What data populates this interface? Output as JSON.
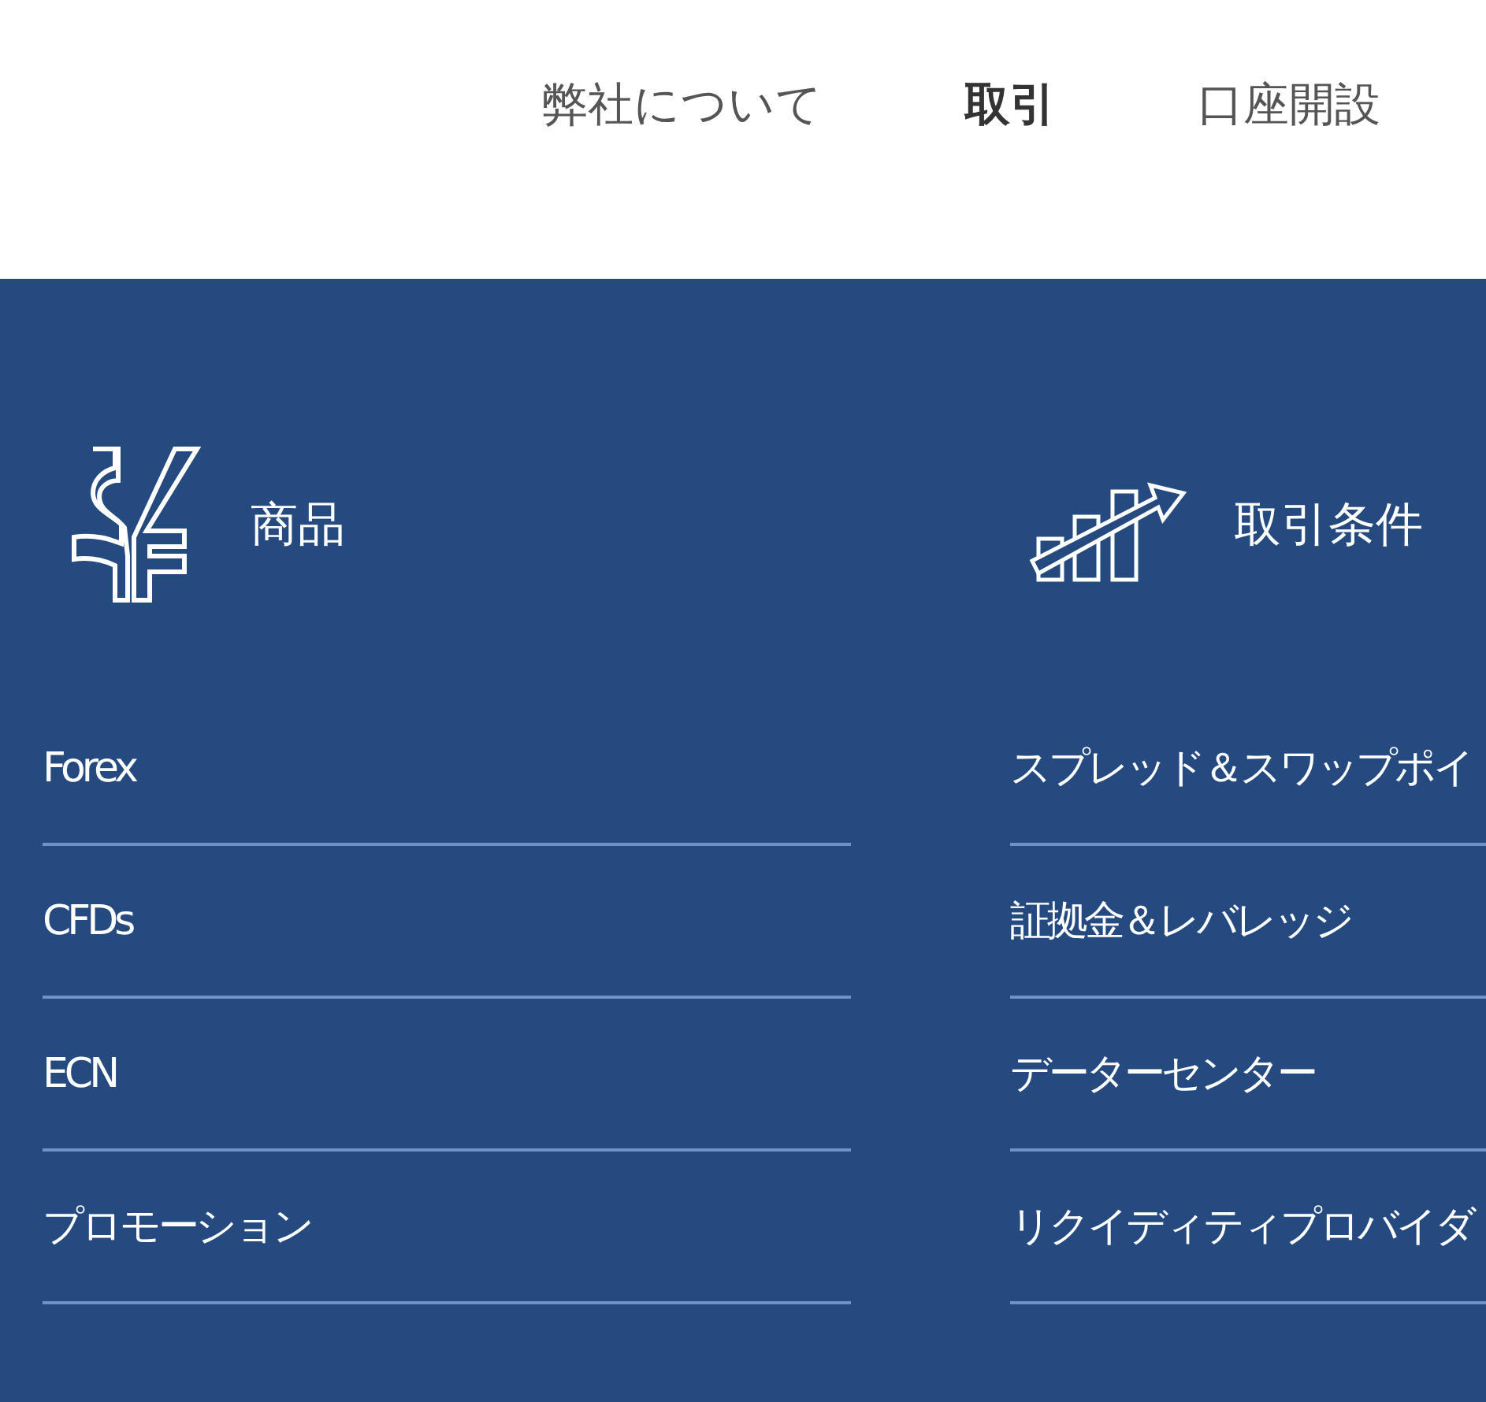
{
  "nav": [
    {
      "label": "弊社について",
      "selected": false
    },
    {
      "label": "取引",
      "selected": true
    },
    {
      "label": "口座開設",
      "selected": false
    }
  ],
  "columns": [
    {
      "kind": "currency",
      "title": "商品",
      "links": [
        "Forex",
        "CFDs",
        "ECN",
        "プロモーション"
      ]
    },
    {
      "kind": "chart",
      "title": "取引条件",
      "links": [
        "スプレッド＆スワップポイ",
        "証拠金＆レバレッジ",
        "データーセンター",
        "リクイディティプロバイダ"
      ]
    }
  ]
}
